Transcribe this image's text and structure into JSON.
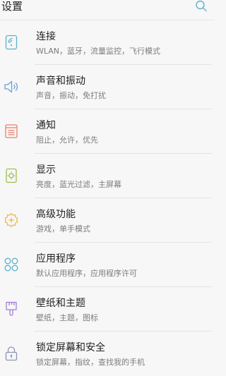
{
  "header": {
    "title": "设置",
    "search_icon": "search-icon"
  },
  "colors": {
    "connect": "#5fb1c9",
    "sound": "#6aa0d8",
    "notify": "#e9806e",
    "display": "#9bbf52",
    "advanced": "#e6b84a",
    "apps": "#5ab1c6",
    "theme": "#a47ed6",
    "lock": "#8a96b3"
  },
  "items": [
    {
      "title": "连接",
      "subtitle": "WLAN，蓝牙，流量监控，飞行模式",
      "icon": "connections-icon"
    },
    {
      "title": "声音和振动",
      "subtitle": "声音，振动，免打扰",
      "icon": "speaker-icon"
    },
    {
      "title": "通知",
      "subtitle": "阻止，允许，优先",
      "icon": "notification-icon"
    },
    {
      "title": "显示",
      "subtitle": "亮度，蓝光过滤，主屏幕",
      "icon": "display-icon"
    },
    {
      "title": "高级功能",
      "subtitle": "游戏，单手模式",
      "icon": "advanced-features-icon"
    },
    {
      "title": "应用程序",
      "subtitle": "默认应用程序，应用程序许可",
      "icon": "apps-icon"
    },
    {
      "title": "壁纸和主题",
      "subtitle": "壁纸，主题，图标",
      "icon": "brush-icon"
    },
    {
      "title": "锁定屏幕和安全",
      "subtitle": "锁定屏幕，指纹，查找我的手机",
      "icon": "lock-icon"
    }
  ]
}
